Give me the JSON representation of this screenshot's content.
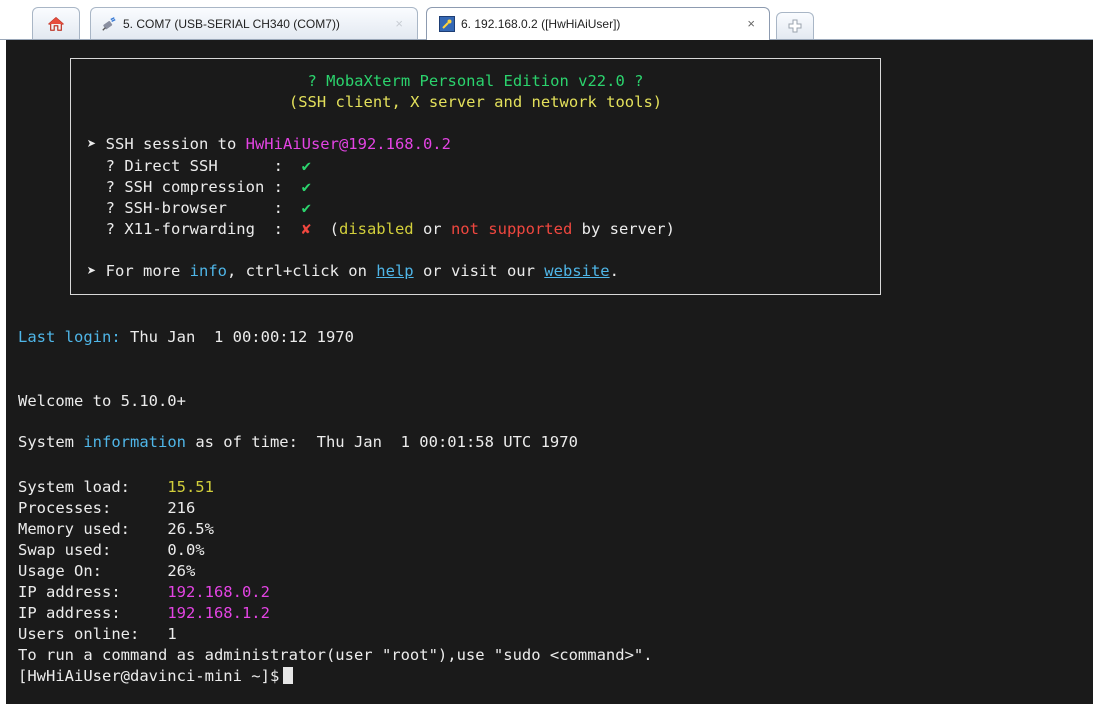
{
  "tabs": [
    {
      "label": "",
      "icon": "home-icon"
    },
    {
      "label": "5. COM7  (USB-SERIAL CH340 (COM7))",
      "icon": "serial-port-icon",
      "close": "×"
    },
    {
      "label": "6. 192.168.0.2 ([HwHiAiUser])",
      "icon": "ssh-session-icon",
      "close": "×",
      "active": true
    },
    {
      "label": "",
      "icon": "new-tab-icon"
    }
  ],
  "banner": {
    "title": "? MobaXterm Personal Edition v22.0 ?",
    "subtitle": "(SSH client, X server and network tools)",
    "session_prefix": "➤ SSH session to ",
    "session_target": "HwHiAiUser@192.168.0.2",
    "features": [
      {
        "name": "  ? Direct SSH      :  ",
        "status": "✔"
      },
      {
        "name": "  ? SSH compression :  ",
        "status": "✔"
      },
      {
        "name": "  ? SSH-browser     :  ",
        "status": "✔"
      },
      {
        "name": "  ? X11-forwarding  :  ",
        "status": "✘"
      }
    ],
    "x11_note": {
      "open": "  (",
      "disabled": "disabled",
      "or": " or ",
      "not_supported": "not supported",
      "tail": " by server)"
    },
    "more": {
      "prefix": "➤ For more ",
      "info": "info",
      "mid": ", ctrl+click on ",
      "help": "help",
      "mid2": " or visit our ",
      "website": "website",
      "end": "."
    }
  },
  "terminal": {
    "last_login_label": "Last login:",
    "last_login_value": " Thu Jan  1 00:00:12 1970",
    "welcome": "Welcome to 5.10.0+",
    "sysinfo_prefix": "System ",
    "sysinfo_word": "information",
    "sysinfo_suffix": " as of time:  Thu Jan  1 00:01:58 UTC 1970",
    "stats": [
      {
        "label": "System load:    ",
        "value": "15.51"
      },
      {
        "label": "Processes:      ",
        "value": "216"
      },
      {
        "label": "Memory used:    ",
        "value": "26.5%"
      },
      {
        "label": "Swap used:      ",
        "value": "0.0%"
      },
      {
        "label": "Usage On:       ",
        "value": "26%"
      },
      {
        "label": "IP address:     ",
        "value": "192.168.0.2"
      },
      {
        "label": "IP address:     ",
        "value": "192.168.1.2"
      },
      {
        "label": "Users online:   ",
        "value": "1"
      }
    ],
    "sudo_hint": "To run a command as administrator(user \"root\"),use \"sudo <command>\".",
    "prompt": "[HwHiAiUser@davinci-mini ~]$"
  },
  "colors": {
    "terminal_bg": "#1a1a1a",
    "green": "#2bd36d",
    "yellow": "#e3e05b",
    "magenta": "#e444e4",
    "cyan": "#4fb6e8",
    "red": "#f0473f"
  }
}
